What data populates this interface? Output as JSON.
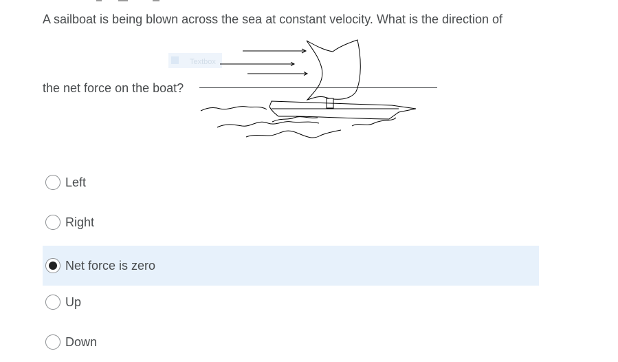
{
  "question": {
    "line1": "A sailboat is being blown across the sea at constant velocity. What is the direction of",
    "line2": "the net force on the boat?",
    "faint_label": "Textbox"
  },
  "choices": [
    {
      "label": "Left",
      "selected": false
    },
    {
      "label": "Right",
      "selected": false
    },
    {
      "label": "Net force is zero",
      "selected": true
    },
    {
      "label": "Up",
      "selected": false
    },
    {
      "label": "Down",
      "selected": false
    }
  ],
  "colors": {
    "text": "#494c4e",
    "selected_bg": "#e7f1fb",
    "radio_border": "#8b8e91",
    "radio_dot": "#222222"
  }
}
